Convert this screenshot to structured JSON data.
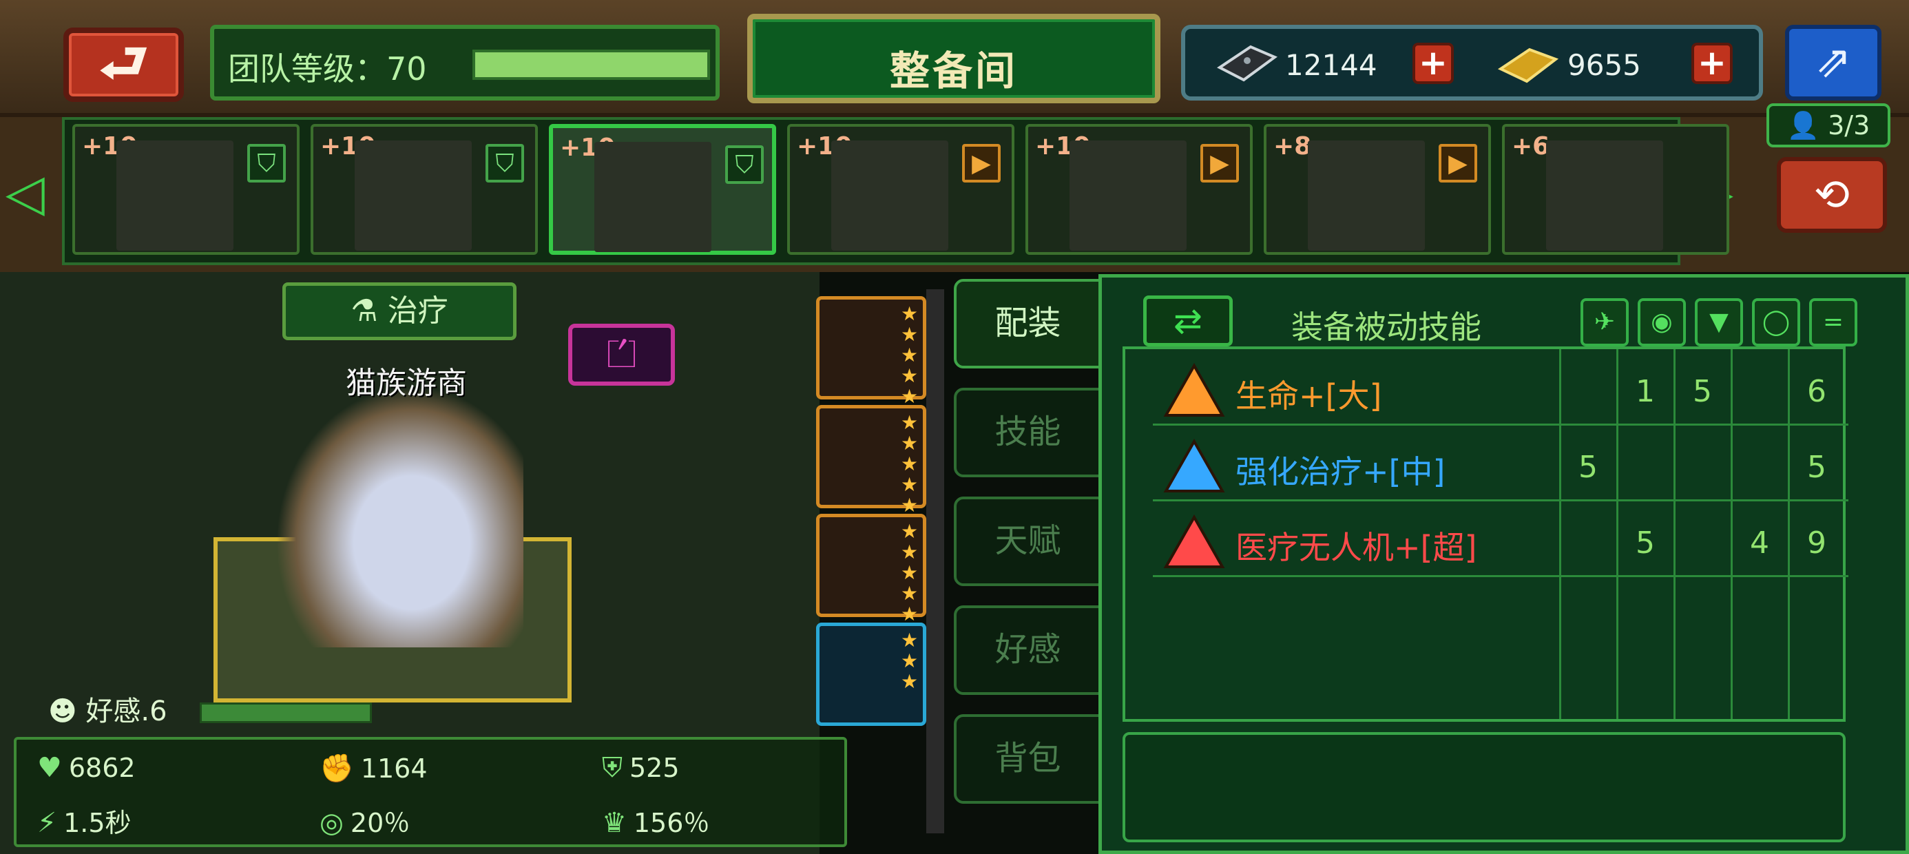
{
  "header": {
    "back_icon": "back-arrow-icon",
    "team_level_label": "团队等级：70",
    "team_level_progress": 1.0,
    "title": "整备间",
    "currency": [
      {
        "icon": "device-chip-icon",
        "value": "12144"
      },
      {
        "icon": "gold-bar-icon",
        "value": "9655"
      }
    ],
    "share_icon": "share-icon"
  },
  "roster": {
    "team_count": "3/3",
    "cards": [
      {
        "plus": "+10",
        "badge": "in-team",
        "selected": false
      },
      {
        "plus": "+10",
        "badge": "in-team",
        "selected": false
      },
      {
        "plus": "+10",
        "badge": "in-team",
        "selected": true
      },
      {
        "plus": "+10",
        "badge": "available",
        "selected": false
      },
      {
        "plus": "+10",
        "badge": "available",
        "selected": false
      },
      {
        "plus": "+8",
        "badge": "available",
        "selected": false
      },
      {
        "plus": "+6",
        "badge": "none",
        "selected": false
      }
    ]
  },
  "character": {
    "role_tag": "治疗",
    "name": "猫族游商",
    "affinity_label": "好感.6",
    "affinity_progress": 1.0
  },
  "stats": {
    "hp": "6862",
    "attack": "1164",
    "defense": "525",
    "attack_speed": "1.5秒",
    "crit": "20％",
    "crit_damage": "156％"
  },
  "equipment": [
    {
      "name": "chest-armor",
      "stars": 5,
      "rarity": "orange"
    },
    {
      "name": "sheep-mount",
      "stars": 5,
      "rarity": "orange"
    },
    {
      "name": "spiked-gear",
      "stars": 5,
      "rarity": "orange"
    },
    {
      "name": "gold-ring",
      "stars": 3,
      "rarity": "blue"
    }
  ],
  "tabs": [
    "配装",
    "技能",
    "天赋",
    "好感",
    "背包"
  ],
  "active_tab": "配装",
  "passive_panel": {
    "title": "装备被动技能",
    "column_icons": [
      "weapon-icon",
      "helmet-icon",
      "armor-icon",
      "ring-icon",
      "equals-icon"
    ],
    "equals_symbol": "=",
    "rows": [
      {
        "name": "生命+[大]",
        "color": "#ff9a2e",
        "values": [
          "",
          "1",
          "5",
          "",
          "6"
        ]
      },
      {
        "name": "强化治疗+[中]",
        "color": "#36a8ff",
        "values": [
          "5",
          "",
          "",
          "",
          "5"
        ]
      },
      {
        "name": "医疗无人机+[超]",
        "color": "#ff4a4a",
        "values": [
          "",
          "5",
          "",
          "4",
          "9"
        ]
      }
    ]
  }
}
